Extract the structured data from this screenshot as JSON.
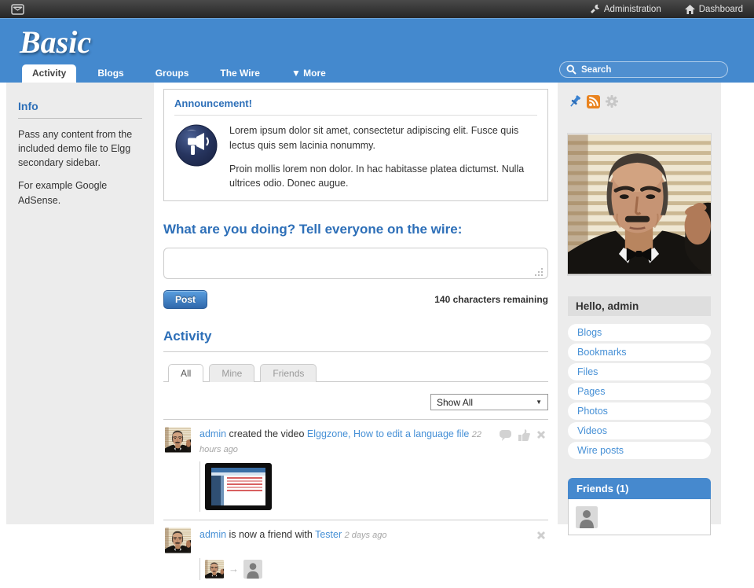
{
  "topbar": {
    "administration_label": "Administration",
    "dashboard_label": "Dashboard"
  },
  "header": {
    "logo_text": "Basic",
    "search_placeholder": "Search"
  },
  "nav": {
    "tabs": [
      {
        "label": "Activity",
        "active": true
      },
      {
        "label": "Blogs",
        "active": false
      },
      {
        "label": "Groups",
        "active": false
      },
      {
        "label": "The Wire",
        "active": false
      },
      {
        "label": "▼ More",
        "active": false
      }
    ]
  },
  "left_sidebar": {
    "title": "Info",
    "paragraph1": "Pass any content from the included demo file to Elgg secondary sidebar.",
    "paragraph2": "For example Google AdSense."
  },
  "announcement": {
    "title": "Announcement!",
    "paragraph1": "Lorem ipsum dolor sit amet, consectetur adipiscing elit. Fusce quis lectus quis sem lacinia nonummy.",
    "paragraph2": "Proin mollis lorem non dolor. In hac habitasse platea dictumst. Nulla ultrices odio. Donec augue."
  },
  "wire": {
    "heading": "What are you doing? Tell everyone on the wire:",
    "input_value": "",
    "post_label": "Post",
    "chars_remaining": "140 characters remaining"
  },
  "activity": {
    "heading": "Activity",
    "tabs": [
      "All",
      "Mine",
      "Friends"
    ],
    "filter_value": "Show All",
    "items": [
      {
        "user": "admin",
        "action": "created the video",
        "object": "Elggzone, How to edit a language file",
        "time": "22 hours ago"
      },
      {
        "user": "admin",
        "action": "is now a friend with",
        "object": "Tester",
        "time": "2 days ago"
      }
    ]
  },
  "right_sidebar": {
    "greeting": "Hello, admin",
    "links": [
      "Blogs",
      "Bookmarks",
      "Files",
      "Pages",
      "Photos",
      "Videos",
      "Wire posts"
    ],
    "friends_title": "Friends (1)"
  },
  "colors": {
    "header_blue": "#4489ce",
    "link_blue": "#4690d6",
    "heading_blue": "#2d6fb8",
    "rss_orange": "#e9831f",
    "topbar_dark": "#2e2e2e",
    "sidebar_gray": "#ececec"
  }
}
